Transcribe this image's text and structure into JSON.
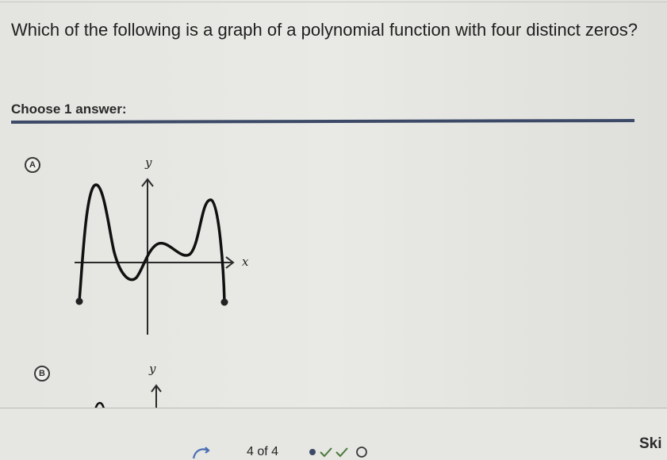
{
  "question": {
    "text": "Which of the following is a graph of a polynomial function with four distinct zeros?"
  },
  "instructions": {
    "text": "Choose 1 answer:"
  },
  "choices": [
    {
      "letter": "A",
      "y_axis_label": "y",
      "x_axis_label": "x"
    },
    {
      "letter": "B",
      "y_axis_label": "y"
    }
  ],
  "footer": {
    "progress": "4 of 4",
    "skip_label": "Ski",
    "progress_states": [
      "current",
      "correct",
      "correct",
      "empty"
    ]
  },
  "colors": {
    "accent": "#3c4a68",
    "curve": "#111111"
  }
}
